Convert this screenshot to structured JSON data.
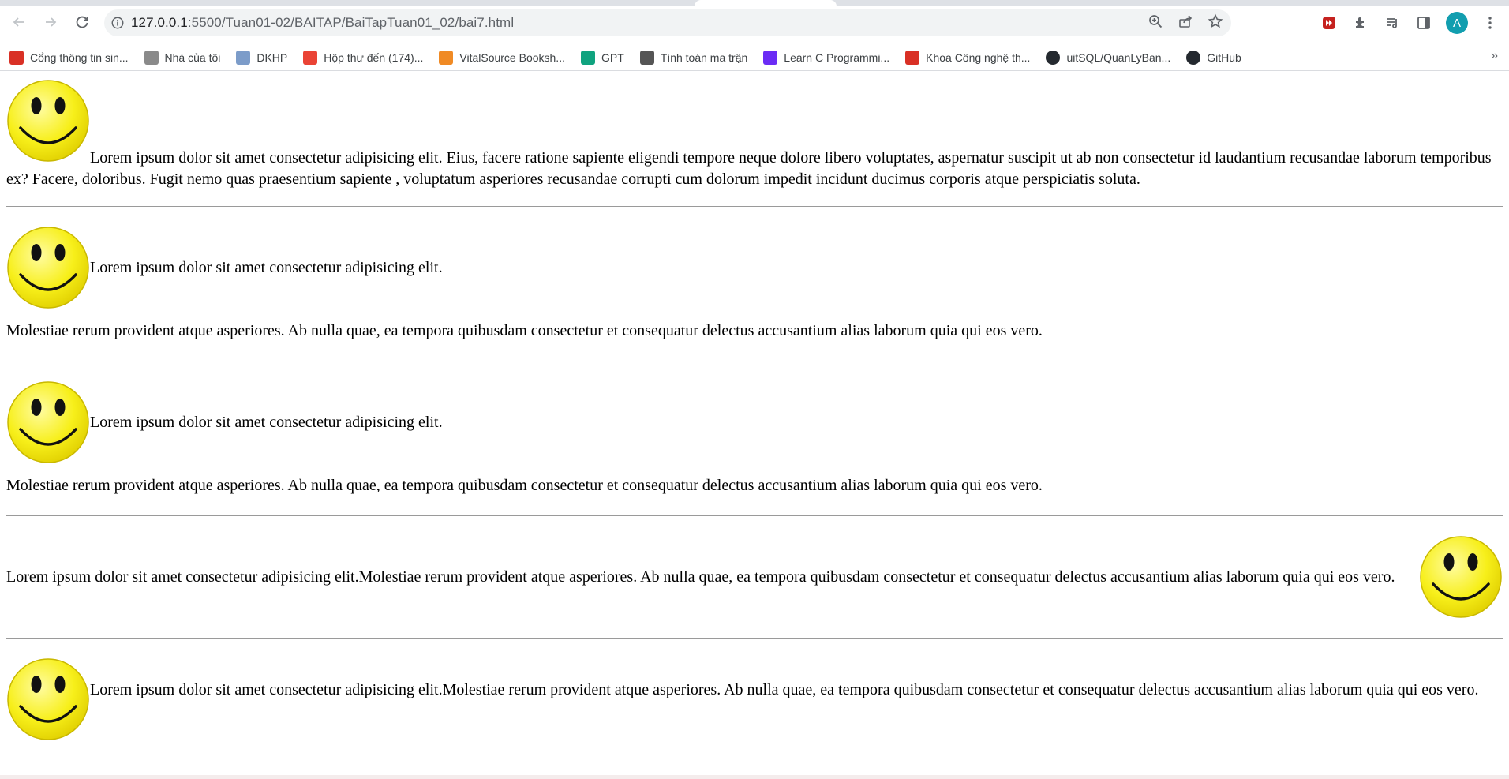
{
  "browser": {
    "url_host": "127.0.0.1",
    "url_rest": ":5500/Tuan01-02/BAITAP/BaiTapTuan01_02/bai7.html",
    "profile_initial": "A",
    "bookmarks": [
      {
        "label": "Cổng thông tin sin...",
        "icon": "uit-logo-icon",
        "color": "#d93025"
      },
      {
        "label": "Nhà của tôi",
        "icon": "home-page-icon",
        "color": "#8a8a8a"
      },
      {
        "label": "DKHP",
        "icon": "document-icon",
        "color": "#7c9cc9"
      },
      {
        "label": "Hộp thư đến (174)...",
        "icon": "gmail-icon",
        "color": "#ea4335"
      },
      {
        "label": "VitalSource Booksh...",
        "icon": "vitalsource-icon",
        "color": "#f08a24"
      },
      {
        "label": "GPT",
        "icon": "openai-icon",
        "color": "#10a37f"
      },
      {
        "label": "Tính toán ma trận",
        "icon": "matrix-icon",
        "color": "#555555"
      },
      {
        "label": "Learn C Programmi...",
        "icon": "programiz-icon",
        "color": "#6b2cf5"
      },
      {
        "label": "Khoa Công nghệ th...",
        "icon": "uit-logo-icon",
        "color": "#d93025"
      },
      {
        "label": "uitSQL/QuanLyBan...",
        "icon": "github-icon",
        "color": "#24292f"
      },
      {
        "label": "GitHub",
        "icon": "github-icon",
        "color": "#24292f"
      }
    ],
    "bookmarks_more": "»"
  },
  "page": {
    "sec1_text": "Lorem ipsum dolor sit amet consectetur adipisicing elit. Eius, facere ratione sapiente eligendi tempore neque dolore libero voluptates, aspernatur suscipit ut ab non consectetur id laudantium recusandae laborum temporibus ex? Facere, doloribus. Fugit nemo quas praesentium sapiente , voluptatum asperiores recusandae corrupti cum dolorum impedit incidunt ducimus corporis atque perspiciatis soluta.",
    "sec2_line1": "Lorem ipsum dolor sit amet consectetur adipisicing elit.",
    "sec2_line2": "Molestiae rerum provident atque asperiores. Ab nulla quae, ea tempora quibusdam consectetur et consequatur delectus accusantium alias laborum quia qui eos vero.",
    "sec3_line1": "Lorem ipsum dolor sit amet consectetur adipisicing elit.",
    "sec3_line2": "Molestiae rerum provident atque asperiores. Ab nulla quae, ea tempora quibusdam consectetur et consequatur delectus accusantium alias laborum quia qui eos vero.",
    "sec4_text": "Lorem ipsum dolor sit amet consectetur adipisicing elit.Molestiae rerum provident atque asperiores. Ab nulla quae, ea tempora quibusdam consectetur et consequatur delectus accusantium alias laborum quia qui eos vero.",
    "sec5_text": "Lorem ipsum dolor sit amet consectetur adipisicing elit.Molestiae rerum provident atque asperiores. Ab nulla quae, ea tempora quibusdam consectetur et consequatur delectus accusantium alias laborum quia qui eos vero."
  },
  "colors": {
    "smiley_face": "#f7ef1a",
    "smiley_edge": "#c9b800"
  }
}
